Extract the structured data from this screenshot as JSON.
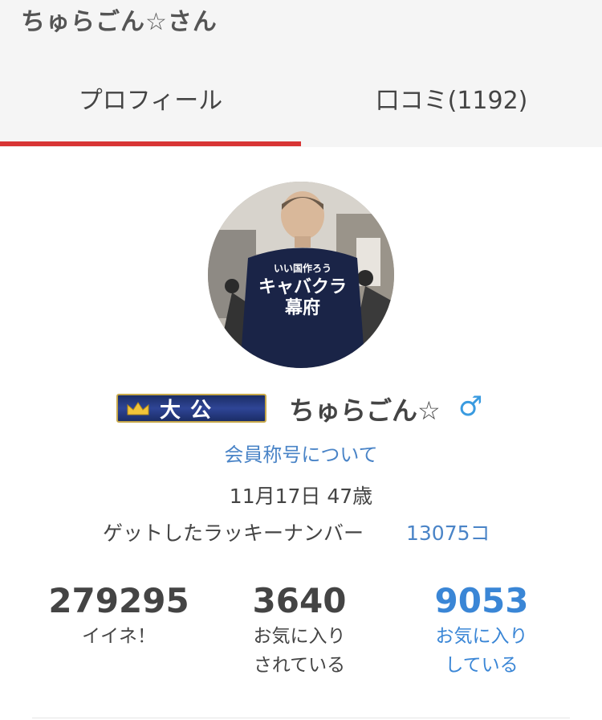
{
  "header": {
    "title": "ちゅらごん☆さん"
  },
  "tabs": [
    {
      "label": "プロフィール",
      "active": true
    },
    {
      "label": "口コミ(1192)",
      "active": false
    }
  ],
  "colors": {
    "active_tab_underline": "#d83535",
    "link": "#4a84c7",
    "gender_male": "#3a9be0",
    "badge_bg": "#2f4596",
    "badge_border": "#c7a84a"
  },
  "profile": {
    "avatar_shirt_text": [
      "いい国作ろう",
      "キャバクラ",
      "幕府"
    ],
    "rank_badge": "大公",
    "rank_badge_icon": "crown-icon",
    "username": "ちゅらごん☆",
    "gender": "♂",
    "title_link": "会員称号について",
    "birthday": "11月17日 47歳",
    "lucky_number_label": "ゲットしたラッキーナンバー",
    "lucky_number_value": "13075コ"
  },
  "stats": [
    {
      "value": "279295",
      "label_lines": [
        "イイネ！"
      ]
    },
    {
      "value": "3640",
      "label_lines": [
        "お気に入り",
        "されている"
      ]
    },
    {
      "value": "9053",
      "label_lines": [
        "お気に入り",
        "している"
      ]
    }
  ]
}
